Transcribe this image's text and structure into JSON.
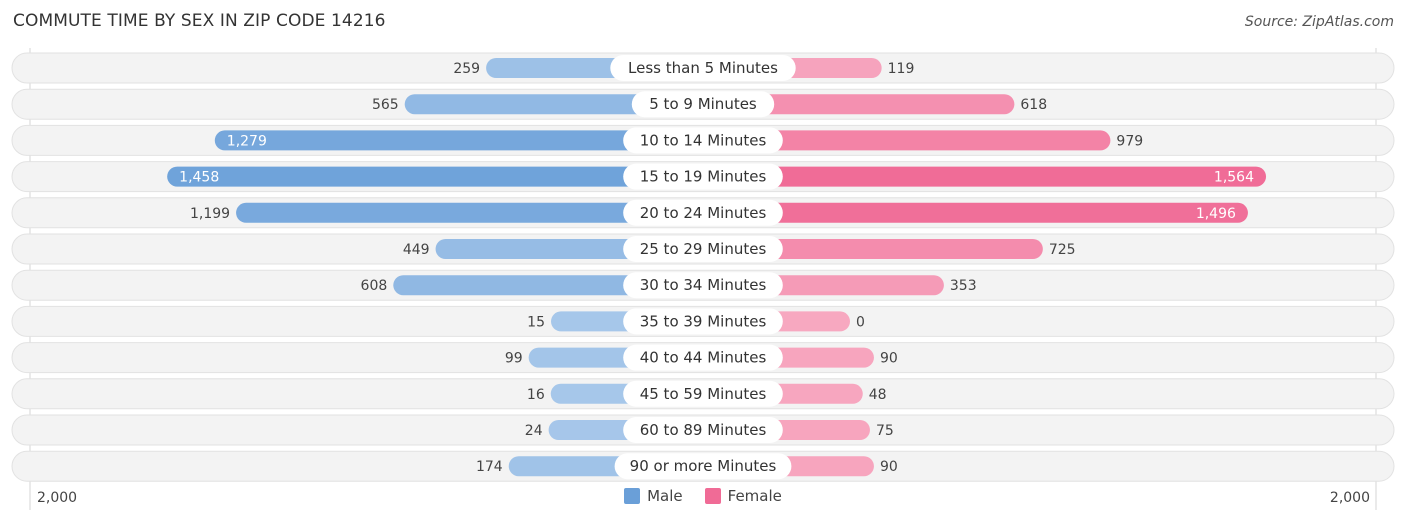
{
  "header": {
    "title": "COMMUTE TIME BY SEX IN ZIP CODE 14216",
    "source": "Source: ZipAtlas.com"
  },
  "colors": {
    "male_dark": "#6a9fd8",
    "male_light": "#a7c7ea",
    "female_dark": "#f06b96",
    "female_light": "#f7a8c0",
    "row_bg": "#f3f3f3",
    "label_bg": "#ffffff"
  },
  "chart_data": {
    "type": "bar",
    "orientation": "horizontal-diverging",
    "title": "COMMUTE TIME BY SEX IN ZIP CODE 14216",
    "categories": [
      "Less than 5 Minutes",
      "5 to 9 Minutes",
      "10 to 14 Minutes",
      "15 to 19 Minutes",
      "20 to 24 Minutes",
      "25 to 29 Minutes",
      "30 to 34 Minutes",
      "35 to 39 Minutes",
      "40 to 44 Minutes",
      "45 to 59 Minutes",
      "60 to 89 Minutes",
      "90 or more Minutes"
    ],
    "series": [
      {
        "name": "Male",
        "values": [
          259,
          565,
          1279,
          1458,
          1199,
          449,
          608,
          15,
          99,
          16,
          24,
          174
        ]
      },
      {
        "name": "Female",
        "values": [
          119,
          618,
          979,
          1564,
          1496,
          725,
          353,
          0,
          90,
          48,
          75,
          90
        ]
      }
    ],
    "value_labels": {
      "male": [
        "259",
        "565",
        "1,279",
        "1,458",
        "1,199",
        "449",
        "608",
        "15",
        "99",
        "16",
        "24",
        "174"
      ],
      "female": [
        "119",
        "618",
        "979",
        "1,564",
        "1,496",
        "725",
        "353",
        "0",
        "90",
        "48",
        "75",
        "90"
      ]
    },
    "axis": {
      "min_label": "2,000",
      "max_label": "2,000",
      "range": [
        -2000,
        2000
      ]
    },
    "legend": {
      "position": "bottom-center",
      "entries": [
        "Male",
        "Female"
      ]
    },
    "grid": false
  }
}
